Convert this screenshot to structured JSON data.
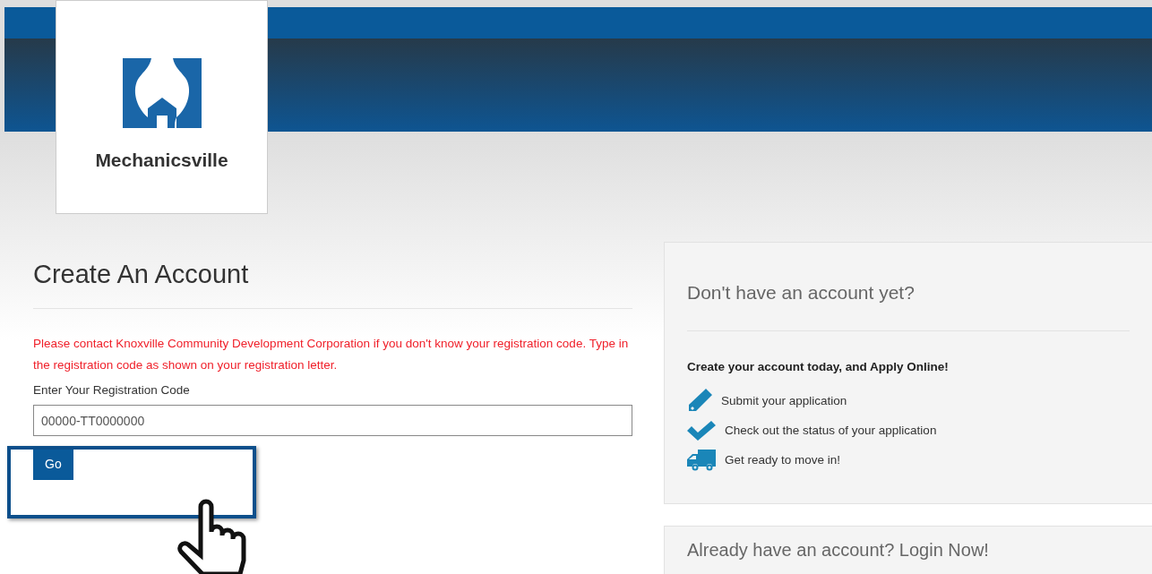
{
  "logo": {
    "name": "Mechanicsville"
  },
  "form": {
    "title": "Create An Account",
    "notice": "Please contact Knoxville Community Development Corporation if you don't know your registration code. Type in the registration code as shown on your registration letter.",
    "label": "Enter Your Registration Code",
    "placeholder": "00000-TT0000000",
    "button": "Go",
    "highlighted": true
  },
  "info_panel": {
    "title": "Don't have an account yet?",
    "subtitle": "Create your account today, and Apply Online!",
    "items": [
      {
        "kind": "pencil",
        "text": "Submit your application"
      },
      {
        "kind": "check",
        "text": "Check out the status of your application"
      },
      {
        "kind": "truck",
        "text": "Get ready to move in!"
      }
    ]
  },
  "login_panel": {
    "title": "Already have an account? Login Now!"
  }
}
